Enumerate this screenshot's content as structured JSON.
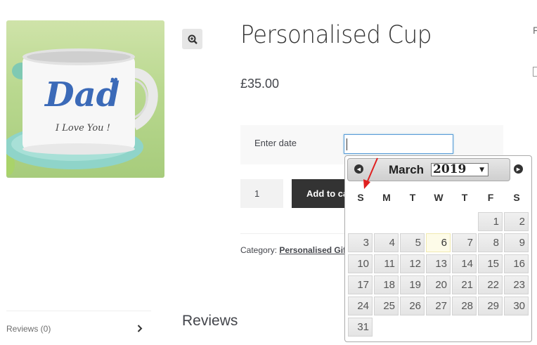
{
  "product": {
    "title": "Personalised Cup",
    "price": "£35.00",
    "image_text": {
      "line1": "Dad",
      "line2": "I Love You !"
    }
  },
  "form": {
    "date_label": "Enter date",
    "date_value": "",
    "quantity": "1",
    "add_to_cart_label": "Add to cart"
  },
  "meta": {
    "category_prefix": "Category:",
    "category_link": "Personalised Gifting"
  },
  "tabs": {
    "reviews_tab": "Reviews (0)",
    "reviews_heading": "Reviews"
  },
  "edge": {
    "letter": "F"
  },
  "datepicker": {
    "month": "March",
    "year": "2019",
    "weekdays": [
      "S",
      "M",
      "T",
      "W",
      "T",
      "F",
      "S"
    ],
    "days": [
      "1",
      "2",
      "3",
      "4",
      "5",
      "6",
      "7",
      "8",
      "9",
      "10",
      "11",
      "12",
      "13",
      "14",
      "15",
      "16",
      "17",
      "18",
      "19",
      "20",
      "21",
      "22",
      "23",
      "24",
      "25",
      "26",
      "27",
      "28",
      "29",
      "30",
      "31"
    ],
    "highlighted_day": "6"
  },
  "colors": {
    "header_bg": "#d6d6d6",
    "highlight_day": "#fdfbe8",
    "annotation_arrow": "#e02020",
    "button_dark": "#333333"
  },
  "icons": {
    "zoom": "zoom-in-icon",
    "prev": "arrow-left-circle-icon",
    "next": "arrow-right-circle-icon",
    "chevron": "chevron-right-icon"
  }
}
